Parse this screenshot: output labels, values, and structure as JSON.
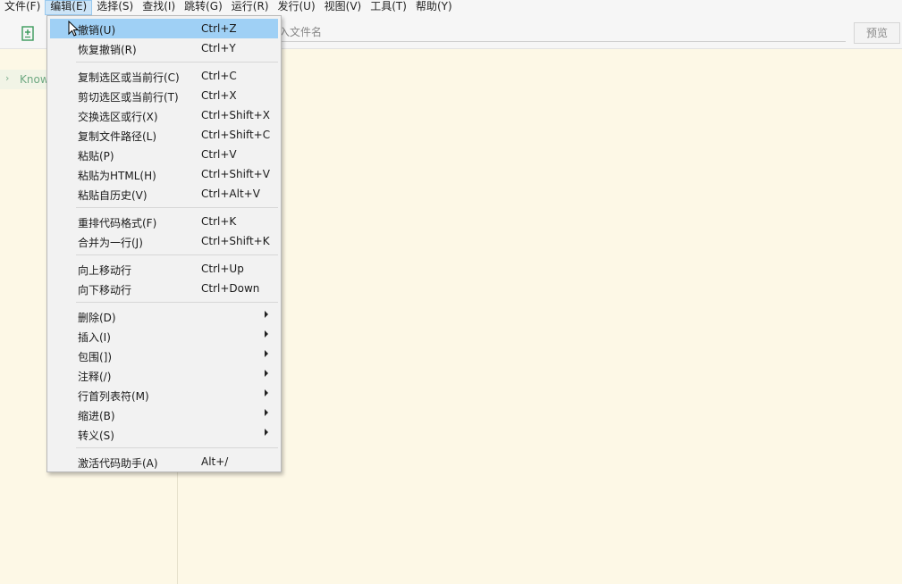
{
  "menubar": {
    "items": [
      {
        "label": "文件(F)"
      },
      {
        "label": "编辑(E)"
      },
      {
        "label": "选择(S)"
      },
      {
        "label": "查找(I)"
      },
      {
        "label": "跳转(G)"
      },
      {
        "label": "运行(R)"
      },
      {
        "label": "发行(U)"
      },
      {
        "label": "视图(V)"
      },
      {
        "label": "工具(T)"
      },
      {
        "label": "帮助(Y)"
      }
    ]
  },
  "toolbar": {
    "filename_placeholder": "入文件名",
    "preview_label": "预览"
  },
  "sidebar": {
    "project_label": "Know"
  },
  "edit_menu": {
    "items": [
      {
        "label": "撤销(U)",
        "shortcut": "Ctrl+Z"
      },
      {
        "label": "恢复撤销(R)",
        "shortcut": "Ctrl+Y"
      },
      {
        "label": "复制选区或当前行(C)",
        "shortcut": "Ctrl+C"
      },
      {
        "label": "剪切选区或当前行(T)",
        "shortcut": "Ctrl+X"
      },
      {
        "label": "交换选区或行(X)",
        "shortcut": "Ctrl+Shift+X"
      },
      {
        "label": "复制文件路径(L)",
        "shortcut": "Ctrl+Shift+C"
      },
      {
        "label": "粘贴(P)",
        "shortcut": "Ctrl+V"
      },
      {
        "label": "粘贴为HTML(H)",
        "shortcut": "Ctrl+Shift+V"
      },
      {
        "label": "粘贴自历史(V)",
        "shortcut": "Ctrl+Alt+V"
      },
      {
        "label": "重排代码格式(F)",
        "shortcut": "Ctrl+K"
      },
      {
        "label": "合并为一行(J)",
        "shortcut": "Ctrl+Shift+K"
      },
      {
        "label": "向上移动行",
        "shortcut": "Ctrl+Up"
      },
      {
        "label": "向下移动行",
        "shortcut": "Ctrl+Down"
      },
      {
        "label": "删除(D)"
      },
      {
        "label": "插入(I)"
      },
      {
        "label": "包围(])"
      },
      {
        "label": "注释(/)"
      },
      {
        "label": "行首列表符(M)"
      },
      {
        "label": "缩进(B)"
      },
      {
        "label": "转义(S)"
      },
      {
        "label": "激活代码助手(A)",
        "shortcut": "Alt+/"
      }
    ]
  },
  "colors": {
    "editor_bg": "#fdf8e6",
    "highlight": "#9fd0f5",
    "tree_accent": "#6ea982"
  }
}
